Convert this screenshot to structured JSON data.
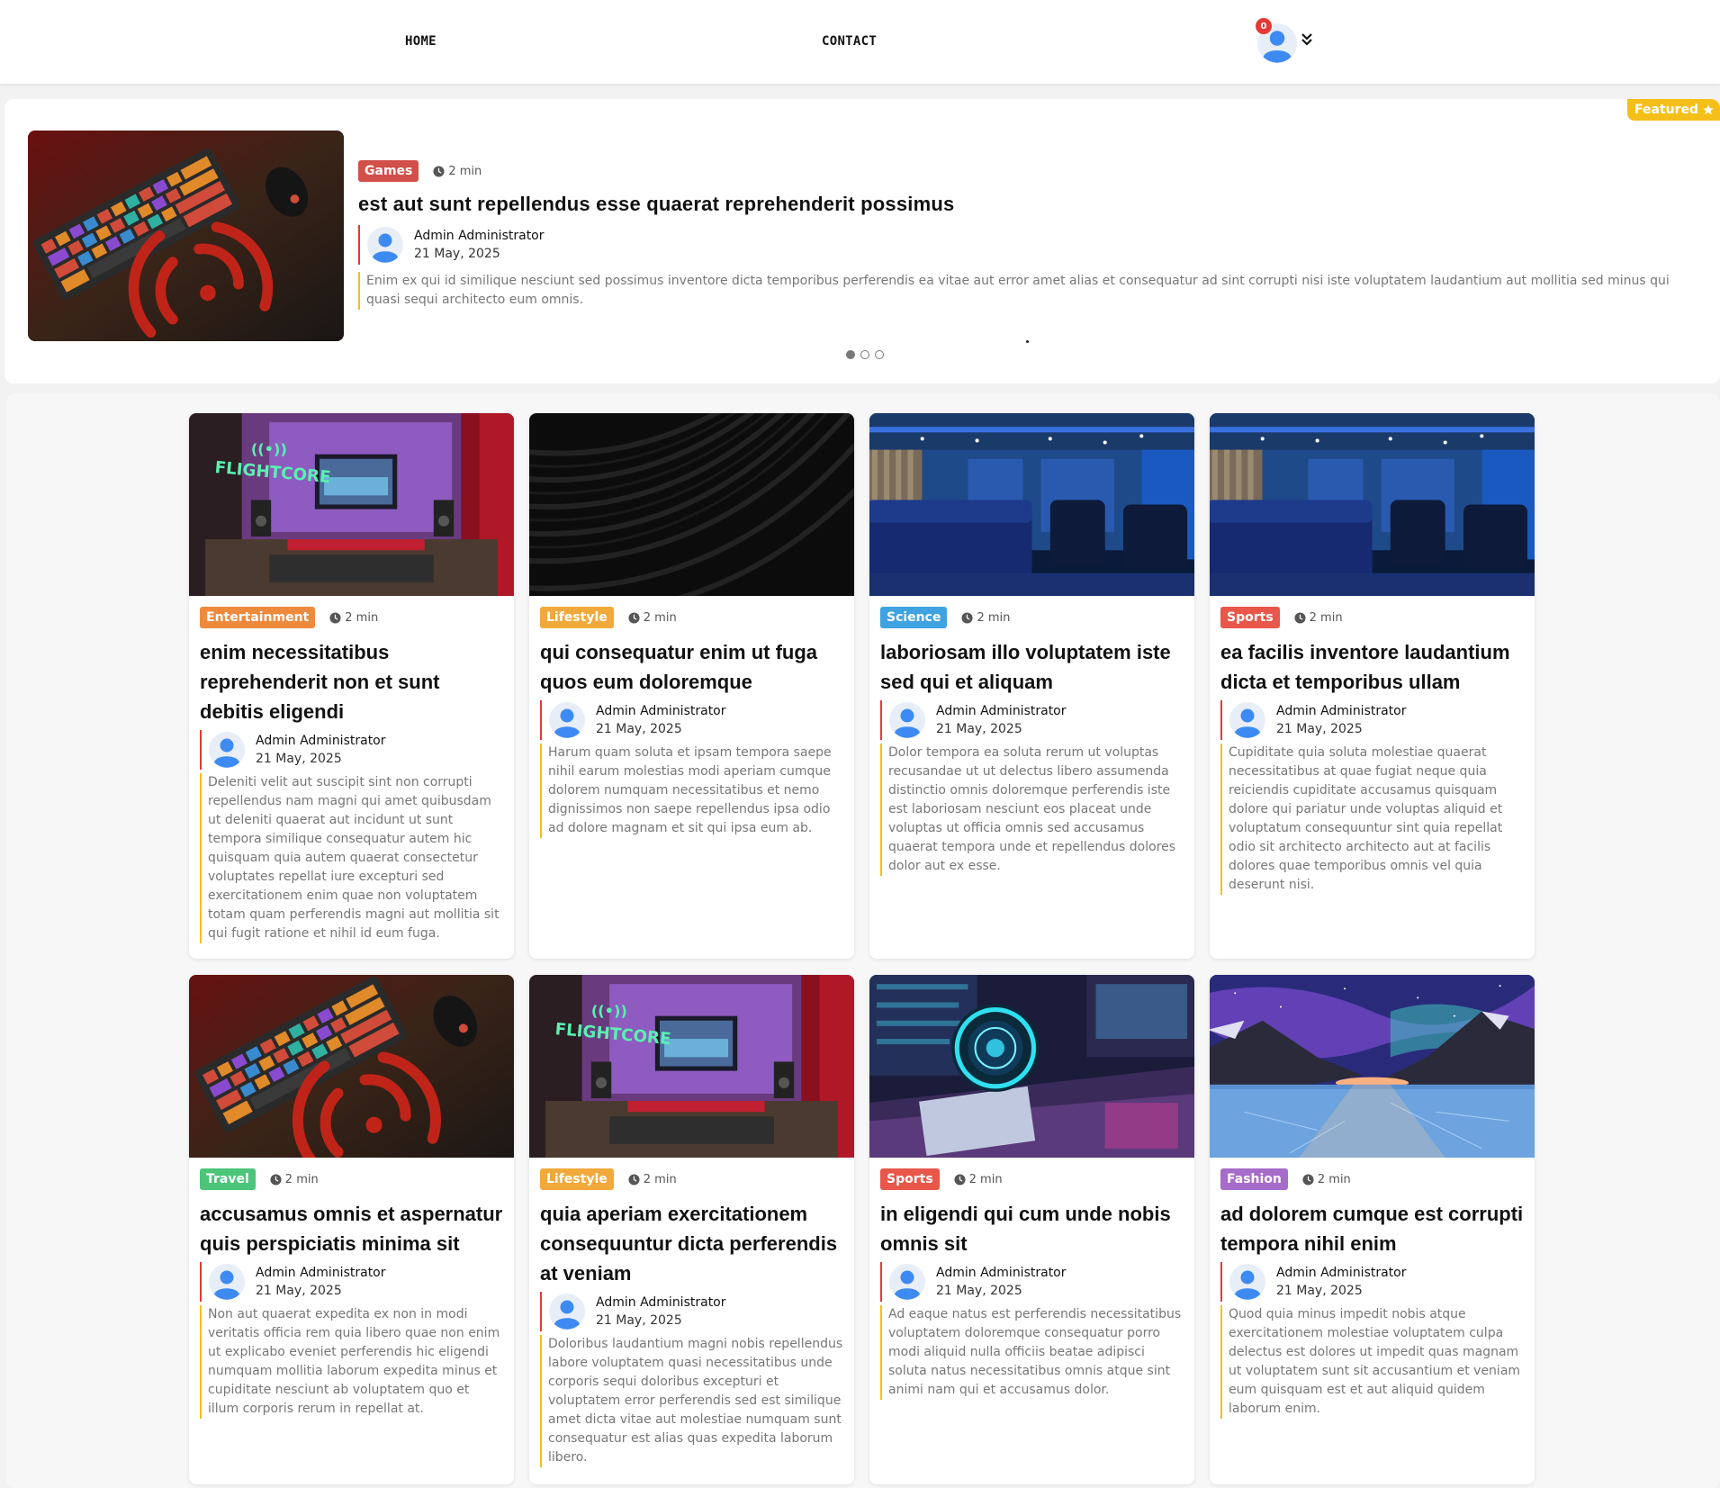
{
  "nav": {
    "home": "HOME",
    "contact": "CONTACT",
    "notification_count": "0"
  },
  "featured": {
    "badge": "Featured",
    "category": "Games",
    "category_color": "#d2504a",
    "read_time": "2 min",
    "title": "est aut sunt repellendus esse quaerat reprehenderit possimus",
    "author": "Admin Administrator",
    "date": "21 May, 2025",
    "excerpt": "Enim ex qui id similique nesciunt sed possimus inventore dicta temporibus perferendis ea vitae aut error amet alias et consequatur ad sint corrupti nisi iste voluptatem laudantium aut mollitia sed minus qui quasi sequi architecto eum omnis.",
    "image": "keyboard-image",
    "carousel_pages": 3,
    "carousel_active": 1
  },
  "colors": {
    "accent_red": "#e53935",
    "accent_yellow": "#f4bf19",
    "avatar_blue": "#3d8bf2"
  },
  "cards": [
    {
      "category": "Entertainment",
      "category_color": "#ef8a3d",
      "read_time": "2 min",
      "title": "enim necessitatibus reprehenderit non et sunt debitis eligendi",
      "author": "Admin Administrator",
      "date": "21 May, 2025",
      "excerpt": "Deleniti velit aut suscipit sint non corrupti repellendus nam magni qui amet quibusdam ut deleniti quaerat aut incidunt ut sunt tempora similique consequatur autem hic quisquam quia autem quaerat consectetur voluptates repellat iure excepturi sed exercitationem enim quae non voluptatem totam quam perferendis magni aut mollitia sit qui fugit ratione et nihil id eum fuga.",
      "image": "studio-neon-image"
    },
    {
      "category": "Lifestyle",
      "category_color": "#f2a93b",
      "read_time": "2 min",
      "title": "qui consequatur enim ut fuga quos eum doloremque",
      "author": "Admin Administrator",
      "date": "21 May, 2025",
      "excerpt": "Harum quam soluta et ipsam tempora saepe nihil earum molestias modi aperiam cumque dolorem numquam necessitatibus et nemo dignissimos non saepe repellendus ipsa odio ad dolore magnam et sit qui ipsa eum ab.",
      "image": "dark-waves-image"
    },
    {
      "category": "Science",
      "category_color": "#3ea3e0",
      "read_time": "2 min",
      "title": "laboriosam illo voluptatem iste sed qui et aliquam",
      "author": "Admin Administrator",
      "date": "21 May, 2025",
      "excerpt": "Dolor tempora ea soluta rerum ut voluptas recusandae ut ut delectus libero assumenda distinctio omnis doloremque perferendis iste est laboriosam nesciunt eos placeat unde voluptas ut officia omnis sed accusamus quaerat tempora unde et repellendus dolores dolor aut ex esse.",
      "image": "blue-studio-image"
    },
    {
      "category": "Sports",
      "category_color": "#e8574a",
      "read_time": "2 min",
      "title": "ea facilis inventore laudantium dicta et temporibus ullam",
      "author": "Admin Administrator",
      "date": "21 May, 2025",
      "excerpt": "Cupiditate quia soluta molestiae quaerat necessitatibus at quae fugiat neque quia reiciendis cupiditate accusamus quisquam dolore qui pariatur unde voluptas aliquid et voluptatum consequuntur sint quia repellat odio sit architecto architecto aut at facilis dolores quae temporibus omnis vel quia deserunt nisi.",
      "image": "blue-studio-image"
    },
    {
      "category": "Travel",
      "category_color": "#4cc47a",
      "read_time": "2 min",
      "title": "accusamus omnis et aspernatur quis perspiciatis minima sit",
      "author": "Admin Administrator",
      "date": "21 May, 2025",
      "excerpt": "Non aut quaerat expedita ex non in modi veritatis officia rem quia libero quae non enim ut explicabo eveniet perferendis hic eligendi numquam mollitia laborum expedita minus et cupiditate nesciunt ab voluptatem quo et illum corporis rerum in repellat at.",
      "image": "keyboard-image"
    },
    {
      "category": "Lifestyle",
      "category_color": "#f2a93b",
      "read_time": "2 min",
      "title": "quia aperiam exercitationem consequuntur dicta perferendis at veniam",
      "author": "Admin Administrator",
      "date": "21 May, 2025",
      "excerpt": "Doloribus laudantium magni nobis repellendus labore voluptatem quasi necessitatibus unde corporis sequi doloribus excepturi et voluptatem error perferendis sed est similique amet dicta vitae aut molestiae numquam sunt consequatur est alias quas expedita laborum libero.",
      "image": "studio-neon-image"
    },
    {
      "category": "Sports",
      "category_color": "#e8574a",
      "read_time": "2 min",
      "title": "in eligendi qui cum unde nobis omnis sit",
      "author": "Admin Administrator",
      "date": "21 May, 2025",
      "excerpt": "Ad eaque natus est perferendis necessitatibus voluptatem doloremque consequatur porro modi aliquid nulla officiis beatae adipisci soluta natus necessitatibus omnis atque sint animi nam qui et accusamus dolor.",
      "image": "neon-desk-image"
    },
    {
      "category": "Fashion",
      "category_color": "#a66cc9",
      "read_time": "2 min",
      "title": "ad dolorem cumque est corrupti tempora nihil enim",
      "author": "Admin Administrator",
      "date": "21 May, 2025",
      "excerpt": "Quod quia minus impedit nobis atque exercitationem molestiae voluptatem culpa delectus est dolores ut impedit quas magnam ut voluptatem sunt sit accusantium et veniam eum quisquam est et aut aliquid quidem laborum enim.",
      "image": "aurora-lake-image"
    }
  ]
}
